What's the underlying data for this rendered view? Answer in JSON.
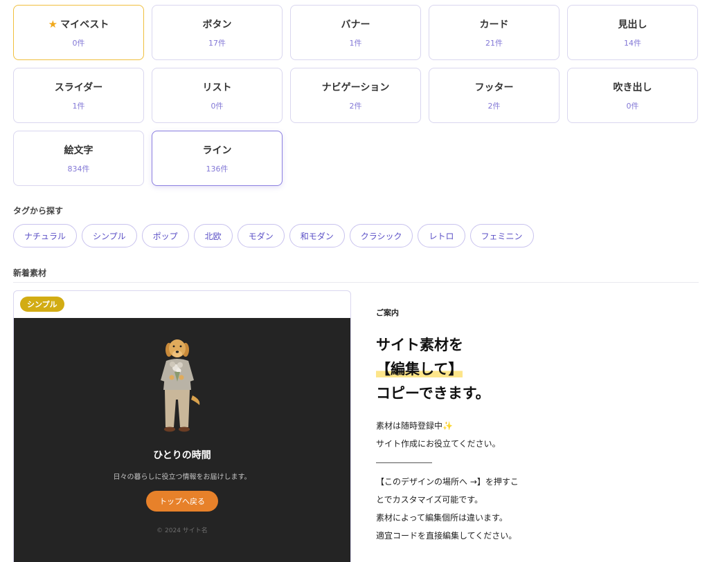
{
  "categories": [
    {
      "name": "マイベスト",
      "count": "0件"
    },
    {
      "name": "ボタン",
      "count": "17件"
    },
    {
      "name": "バナー",
      "count": "1件"
    },
    {
      "name": "カード",
      "count": "21件"
    },
    {
      "name": "見出し",
      "count": "14件"
    },
    {
      "name": "スライダー",
      "count": "1件"
    },
    {
      "name": "リスト",
      "count": "0件"
    },
    {
      "name": "ナビゲーション",
      "count": "2件"
    },
    {
      "name": "フッター",
      "count": "2件"
    },
    {
      "name": "吹き出し",
      "count": "0件"
    },
    {
      "name": "絵文字",
      "count": "834件"
    },
    {
      "name": "ライン",
      "count": "136件"
    }
  ],
  "tags_section": {
    "label": "タグから探す",
    "tags": [
      "ナチュラル",
      "シンプル",
      "ポップ",
      "北欧",
      "モダン",
      "和モダン",
      "クラシック",
      "レトロ",
      "フェミニン"
    ]
  },
  "new_section": {
    "label": "新着素材"
  },
  "preview": {
    "badge": "シンプル",
    "title": "ひとりの時間",
    "description": "日々の暮らしに役立つ情報をお届けします。",
    "button": "トップへ戻る",
    "copyright": "© 2024 サイト名",
    "colors": {
      "background": "#242424",
      "button": "#e7812a",
      "badge": "#d2ac14"
    }
  },
  "info": {
    "label": "ご案内",
    "headline_line1": "サイト素材を",
    "headline_line2": "【編集して】",
    "headline_line3": "コピーできます。",
    "text_line1": "素材は随時登録中✨",
    "text_line2": "サイト作成にお役立てください。",
    "text_line3": "【このデザインの場所へ →】を押すこ",
    "text_line4": "とでカスタマイズ可能です。",
    "text_line5": "素材によって編集個所は違います。",
    "text_line6": "適宜コードを直接編集してください。"
  },
  "icons": {
    "favorite": "star-icon",
    "illustration": "dog-illustration"
  }
}
